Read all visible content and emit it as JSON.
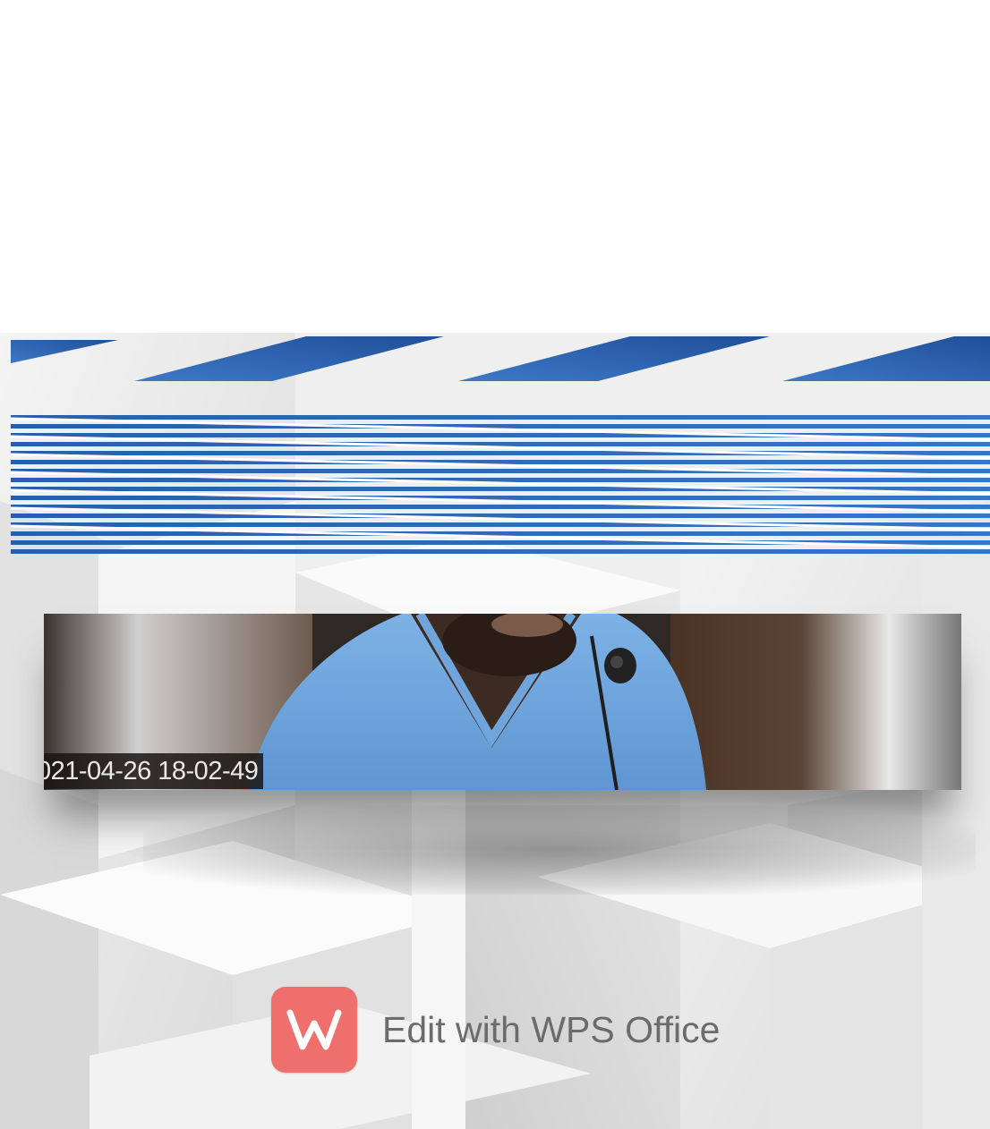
{
  "video": {
    "timestamp": "021-04-26 18-02-49"
  },
  "watermark": {
    "icon": "wps-office-logo-icon",
    "label": "Edit with WPS Office",
    "logo_color": "#ee6f6c"
  },
  "colors": {
    "banner_blue": "#2f64b3",
    "shirt_blue": "#6aa2dc"
  }
}
